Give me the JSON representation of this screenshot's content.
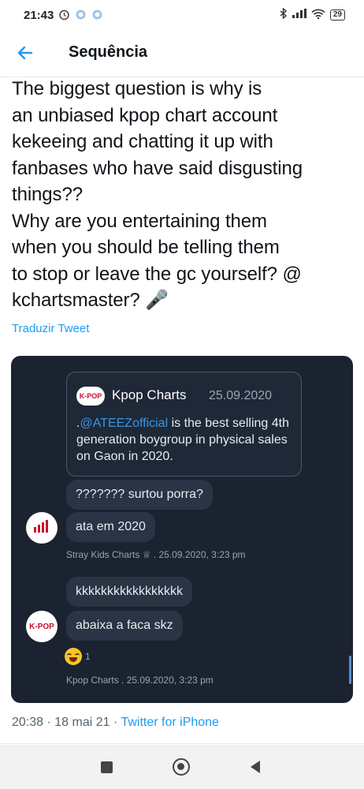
{
  "status_bar": {
    "time": "21:43",
    "battery": "29"
  },
  "header": {
    "title": "Sequência"
  },
  "tweet": {
    "text": "The biggest question is why is\nan unbiased kpop chart account\nkekeeing and chatting it up with\nfanbases who have said disgusting\nthings??\nWhy are you entertaining them\nwhen you should be telling them\nto stop or leave the gc yourself? @\nkchartsmaster? 🎤",
    "translate_label": "Traduzir Tweet",
    "timestamp": "20:38 · 18 mai 21 · ",
    "source": "Twitter for iPhone"
  },
  "image": {
    "quote": {
      "logo_text": "K-POP",
      "name": "Kpop Charts",
      "date": "25.09.2020",
      "body_prefix": ".",
      "mention": "@ATEEZofficial",
      "body_rest": " is the best selling 4th generation boygroup in physical sales on Gaon in 2020."
    },
    "messages": [
      {
        "text": "??????? surtou porra?"
      },
      {
        "text": "ata em 2020"
      },
      {
        "text": "kkkkkkkkkkkkkkkkk"
      },
      {
        "text": "abaixa a faca skz"
      }
    ],
    "meta_1": "Stray Kids Charts ♕ . 25.09.2020, 3:23 pm",
    "meta_2": "Kpop Charts . 25.09.2020, 3:23 pm",
    "avatar_2_text": "K-POP",
    "reaction_count": "1"
  },
  "icons": {
    "back": "arrow-left-icon",
    "alarm": "alarm-icon",
    "bluetooth": "bluetooth-icon",
    "signal": "signal-icon",
    "wifi": "wifi-icon",
    "battery": "battery-icon"
  },
  "colors": {
    "accent": "#1d9bf0",
    "card_bg": "#1b2230",
    "bubble_bg": "#2a3444"
  }
}
